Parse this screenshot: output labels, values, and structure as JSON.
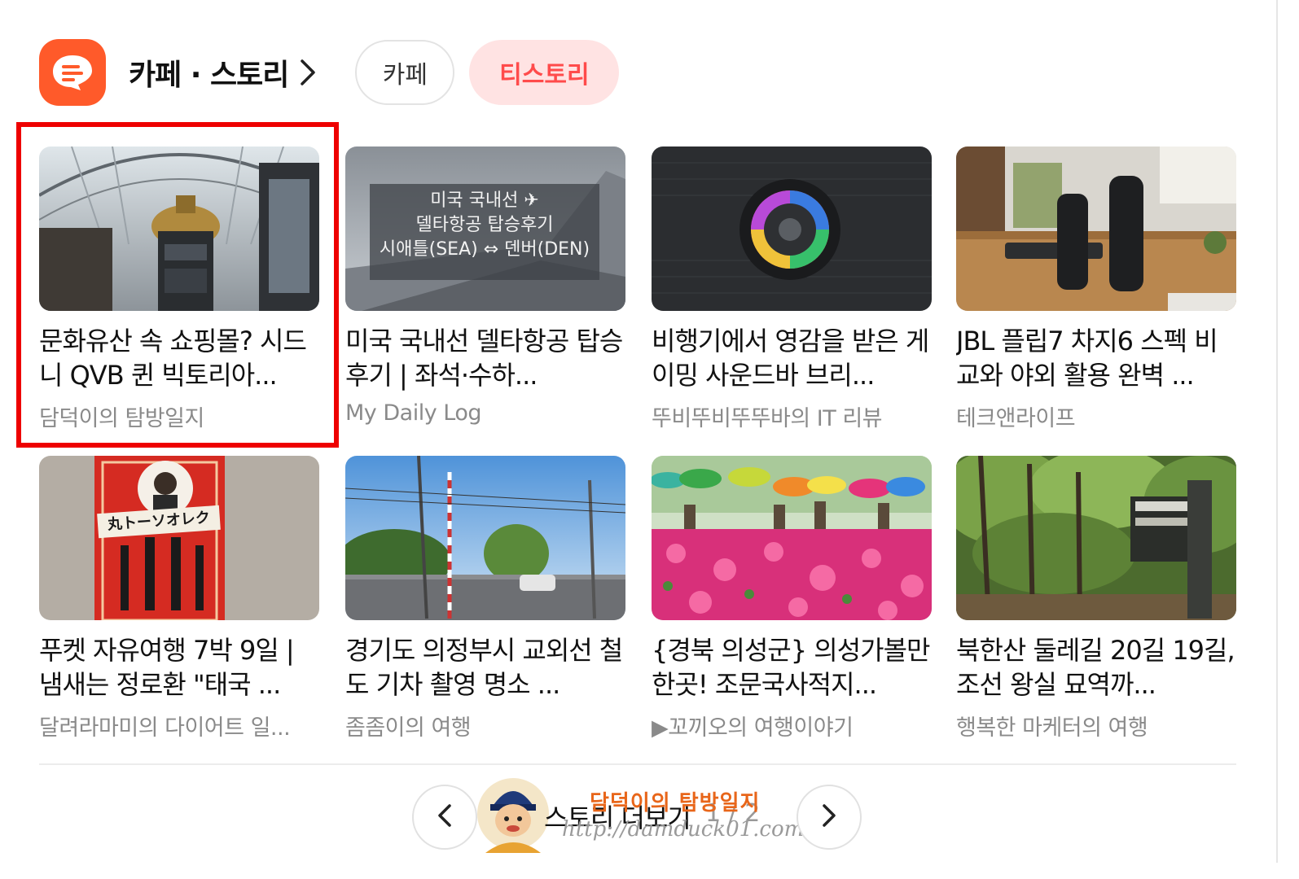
{
  "header": {
    "title": "카페 · 스토리",
    "tabs": [
      {
        "label": "카페",
        "selected": false
      },
      {
        "label": "티스토리",
        "selected": true
      }
    ]
  },
  "colors": {
    "accent": "#ff5a2a",
    "selected_tab_bg": "#ffe3e3",
    "selected_tab_text": "#ff4b4b",
    "highlight_box": "#ee0000"
  },
  "cards": [
    {
      "title": "문화유산 속 쇼핑몰? 시드니 QVB 퀸 빅토리아...",
      "blog": "담덕이의 탐방일지",
      "image": "shopping-arcade-dome"
    },
    {
      "title": "미국 국내선 델타항공 탑승 후기 | 좌석·수하...",
      "blog": "My Daily Log",
      "image": "airplane-wing",
      "overlay": [
        "미국 국내선 ✈",
        "델타항공 탑승후기",
        "시애틀(SEA) ⇔ 덴버(DEN)"
      ]
    },
    {
      "title": "비행기에서 영감을 받은 게이밍 사운드바 브리...",
      "blog": "뚜비뚜비뚜뚜바의 IT 리뷰",
      "image": "soundbar-rgb"
    },
    {
      "title": "JBL 플립7 차지6 스펙 비교와 야외 활용 완벽 ...",
      "blog": "테크앤라이프",
      "image": "jbl-speakers"
    },
    {
      "title": "푸켓 자유여행 7박 9일 | 냄새는 정로환 \"태국 ...",
      "blog": "달려라마미의 다이어트 일...",
      "image": "medicine-box",
      "overlay": [
        "丸トーソオレク"
      ]
    },
    {
      "title": "경기도 의정부시 교외선 철도 기차 촬영 명소 ...",
      "blog": "좀좀이의 여행",
      "image": "railroad-crossing"
    },
    {
      "title": "{경북 의성군} 의성가볼만한곳! 조문국사적지...",
      "blog": "▶꼬끼오의 여행이야기",
      "image": "flower-field-umbrellas"
    },
    {
      "title": "북한산 둘레길 20길 19길, 조선 왕실 묘역까...",
      "blog": "행복한 마케터의 여행",
      "image": "forest-trail-sign"
    }
  ],
  "pager": {
    "more_label": "스토리 더보기",
    "page_text": "1 / 2",
    "prev_icon": "chevron-left-icon",
    "next_icon": "chevron-right-icon"
  },
  "watermark": {
    "name": "담덕이의 탐방일지",
    "url": "http://damduck01.com"
  }
}
